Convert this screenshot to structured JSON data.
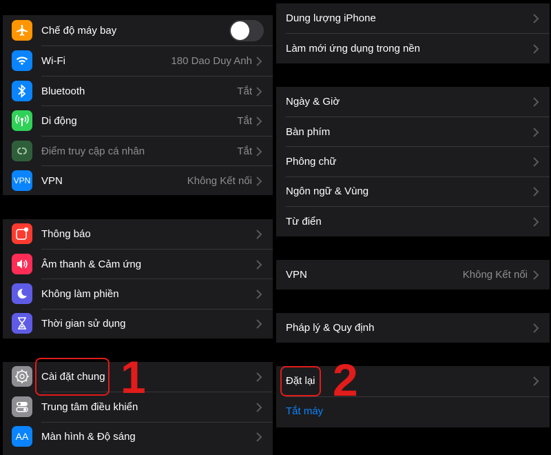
{
  "left": {
    "group1": [
      {
        "label": "Chế độ máy bay",
        "icon": "airplane-icon",
        "color": "#ff9500",
        "toggle": false
      },
      {
        "label": "Wi-Fi",
        "value": "180 Dao Duy Anh",
        "icon": "wifi-icon",
        "color": "#0a84ff"
      },
      {
        "label": "Bluetooth",
        "value": "Tắt",
        "icon": "bluetooth-icon",
        "color": "#0a84ff"
      },
      {
        "label": "Di động",
        "value": "Tắt",
        "icon": "cellular-icon",
        "color": "#30d158"
      },
      {
        "label": "Điểm truy cập cá nhân",
        "value": "Tắt",
        "icon": "hotspot-icon",
        "color": "#30d158"
      },
      {
        "label": "VPN",
        "value": "Không Kết nối",
        "icon": "vpn-icon",
        "icon_text": "VPN",
        "color": "#0a84ff"
      }
    ],
    "group2": [
      {
        "label": "Thông báo",
        "icon": "notifications-icon",
        "color": "#ff3b30"
      },
      {
        "label": "Âm thanh & Cảm ứng",
        "icon": "sound-icon",
        "color": "#ff2d55"
      },
      {
        "label": "Không làm phiền",
        "icon": "moon-icon",
        "color": "#5e5ce6"
      },
      {
        "label": "Thời gian sử dụng",
        "icon": "hourglass-icon",
        "color": "#5e5ce6"
      }
    ],
    "group3": [
      {
        "label": "Cài đặt chung",
        "icon": "gear-icon",
        "color": "#8e8e93"
      },
      {
        "label": "Trung tâm điều khiển",
        "icon": "control-center-icon",
        "color": "#8e8e93"
      },
      {
        "label": "Màn hình & Độ sáng",
        "icon": "display-icon",
        "icon_text": "AA",
        "color": "#0a84ff"
      }
    ]
  },
  "right": {
    "group1": [
      {
        "label": "Dung lượng iPhone"
      },
      {
        "label": "Làm mới ứng dụng trong nền"
      }
    ],
    "group2": [
      {
        "label": "Ngày & Giờ"
      },
      {
        "label": "Bàn phím"
      },
      {
        "label": "Phông chữ"
      },
      {
        "label": "Ngôn ngữ & Vùng"
      },
      {
        "label": "Từ điển"
      }
    ],
    "group3": [
      {
        "label": "VPN",
        "value": "Không Kết nối"
      }
    ],
    "group4": [
      {
        "label": "Pháp lý & Quy định"
      }
    ],
    "group5": [
      {
        "label": "Đặt lại"
      },
      {
        "label": "Tắt máy"
      }
    ]
  },
  "annotations": {
    "step1": "1",
    "step2": "2",
    "highlight_color": "#e21b1b"
  }
}
